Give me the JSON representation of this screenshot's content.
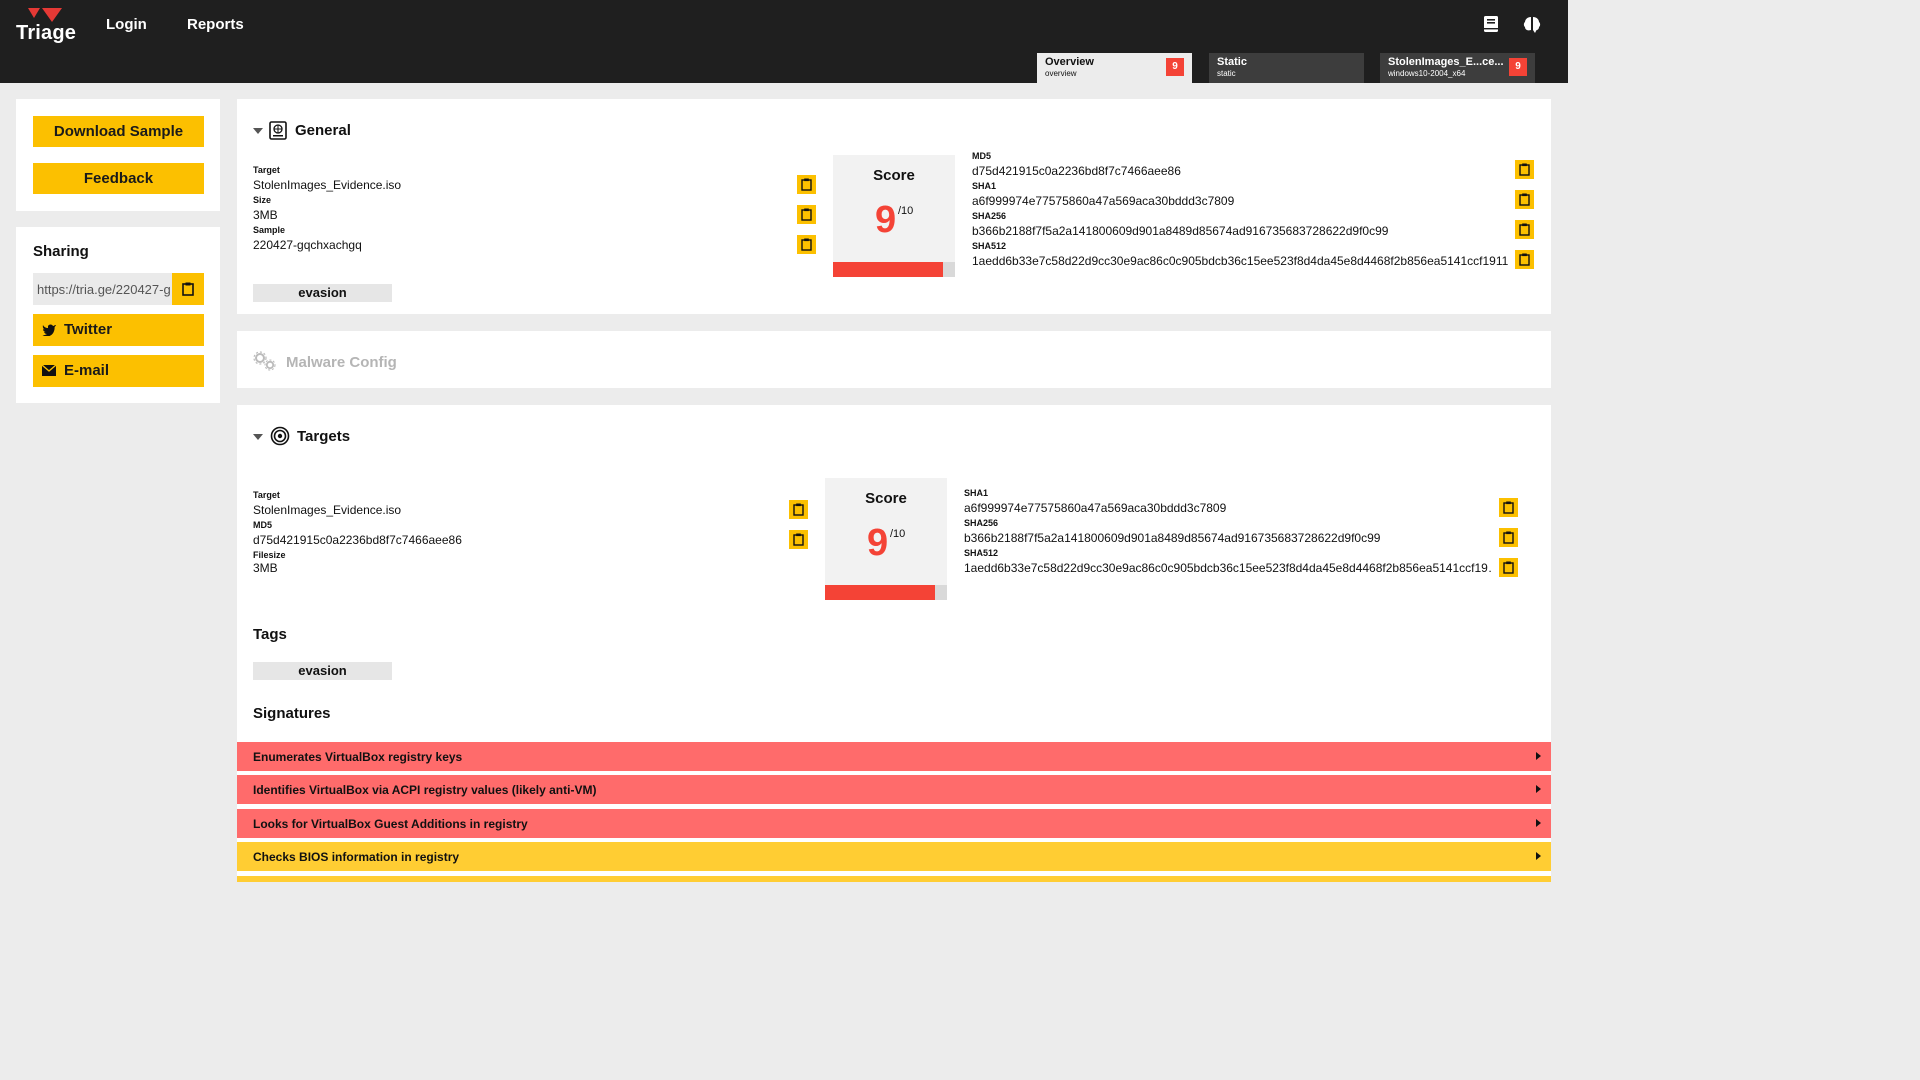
{
  "header": {
    "logo_text": "Triage",
    "nav": [
      "Login",
      "Reports"
    ],
    "icons": [
      "book-icon",
      "brain-icon"
    ]
  },
  "tabs": [
    {
      "title": "Overview",
      "sub": "overview",
      "badge": "9"
    },
    {
      "title": "Static",
      "sub": "static",
      "badge": ""
    },
    {
      "title": "StolenImages_E...ce...",
      "sub": "windows10-2004_x64",
      "badge": "9"
    }
  ],
  "sidebar": {
    "download": "Download Sample",
    "feedback": "Feedback",
    "sharing_title": "Sharing",
    "share_url": "https://tria.ge/220427-g",
    "twitter": "Twitter",
    "email": "E-mail"
  },
  "general": {
    "title": "General",
    "target_label": "Target",
    "target": "StolenImages_Evidence.iso",
    "size_label": "Size",
    "size": "3MB",
    "sample_label": "Sample",
    "sample": "220427-gqchxachgq",
    "tag": "evasion",
    "score_title": "Score",
    "score": "9",
    "score_max": "/10",
    "score_fraction": 0.9,
    "md5_label": "MD5",
    "md5": "d75d421915c0a2236bd8f7c7466aee86",
    "sha1_label": "SHA1",
    "sha1": "a6f999974e77575860a47a569aca30bddd3c7809",
    "sha256_label": "SHA256",
    "sha256": "b366b2188f7f5a2a141800609d901a8489d85674ad916735683728622d9f0c99",
    "sha512_label": "SHA512",
    "sha512": "1aedd6b33e7c58d22d9cc30e9ac86c0c905bdcb36c15ee523f8d4da45e8d4468f2b856ea5141ccf1911…"
  },
  "malware_config": {
    "title": "Malware Config"
  },
  "targets": {
    "title": "Targets",
    "target_label": "Target",
    "target": "StolenImages_Evidence.iso",
    "md5_label": "MD5",
    "md5": "d75d421915c0a2236bd8f7c7466aee86",
    "filesize_label": "Filesize",
    "filesize": "3MB",
    "score_title": "Score",
    "score": "9",
    "score_max": "/10",
    "score_fraction": 0.9,
    "sha1_label": "SHA1",
    "sha1": "a6f999974e77575860a47a569aca30bddd3c7809",
    "sha256_label": "SHA256",
    "sha256": "b366b2188f7f5a2a141800609d901a8489d85674ad916735683728622d9f0c99",
    "sha512_label": "SHA512",
    "sha512": "1aedd6b33e7c58d22d9cc30e9ac86c0c905bdcb36c15ee523f8d4da45e8d4468f2b856ea5141ccf19…",
    "tags_title": "Tags",
    "tag": "evasion",
    "signatures_title": "Signatures"
  },
  "signatures": [
    {
      "label": "Enumerates VirtualBox registry keys",
      "severity": "high"
    },
    {
      "label": "Identifies VirtualBox via ACPI registry values (likely anti-VM)",
      "severity": "high"
    },
    {
      "label": "Looks for VirtualBox Guest Additions in registry",
      "severity": "high"
    },
    {
      "label": "Checks BIOS information in registry",
      "severity": "medium"
    }
  ],
  "colors": {
    "accent_yellow": "#fcc000",
    "danger_red": "#f44336",
    "sig_high": "#ff6b6b",
    "sig_medium": "#ffcd33",
    "topbar": "#1f1f1f"
  }
}
